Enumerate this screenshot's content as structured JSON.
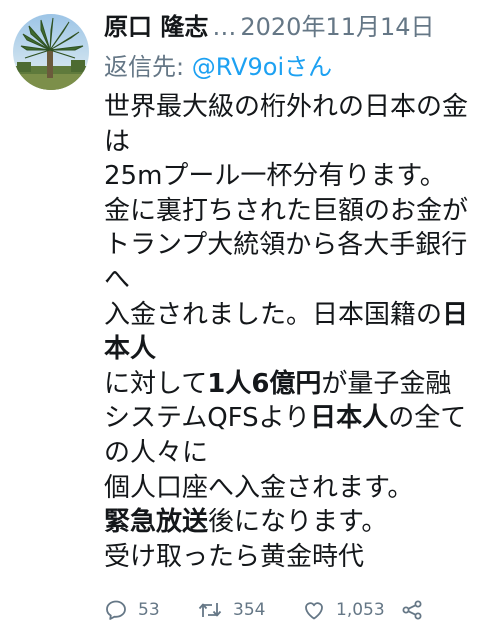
{
  "tweet": {
    "display_name": "原口 隆志",
    "ellipsis": "…",
    "date": "2020年11月14日",
    "reply_prefix": "返信先: ",
    "reply_handle": "@RV9oi",
    "reply_suffix": "さん",
    "body_lines": [
      [
        {
          "t": "世界最大級の桁外れの日本の金"
        }
      ],
      [
        {
          "t": "は"
        }
      ],
      [
        {
          "t": "25mプール一杯分有ります。"
        }
      ],
      [
        {
          "t": "金に裏打ちされた巨額のお金が"
        }
      ],
      [
        {
          "t": "トランプ大統領から各大手銀行"
        }
      ],
      [
        {
          "t": "へ"
        }
      ],
      [
        {
          "t": "入金されました。日本国籍の"
        },
        {
          "t": "日",
          "b": true
        }
      ],
      [
        {
          "t": "本人",
          "b": true
        }
      ],
      [
        {
          "t": "に対して"
        },
        {
          "t": "1人6億円",
          "b": true
        },
        {
          "t": "が量子金融"
        }
      ],
      [
        {
          "t": "システムQFSより"
        },
        {
          "t": "日本人",
          "b": true
        },
        {
          "t": "の全て"
        }
      ],
      [
        {
          "t": "の人々に"
        }
      ],
      [
        {
          "t": "個人口座へ入金されます。"
        }
      ],
      [
        {
          "t": "緊急放送",
          "b": true
        },
        {
          "t": "後になります。"
        }
      ],
      [
        {
          "t": "受け取ったら黄金時代"
        }
      ]
    ]
  },
  "actions": {
    "reply_count": "53",
    "retweet_count": "354",
    "like_count": "1,053"
  },
  "icons": {
    "reply": "reply-icon",
    "retweet": "retweet-icon",
    "like": "heart-icon",
    "share": "share-icon"
  },
  "colors": {
    "text": "#14171a",
    "muted": "#657786",
    "link": "#1da1f2"
  }
}
